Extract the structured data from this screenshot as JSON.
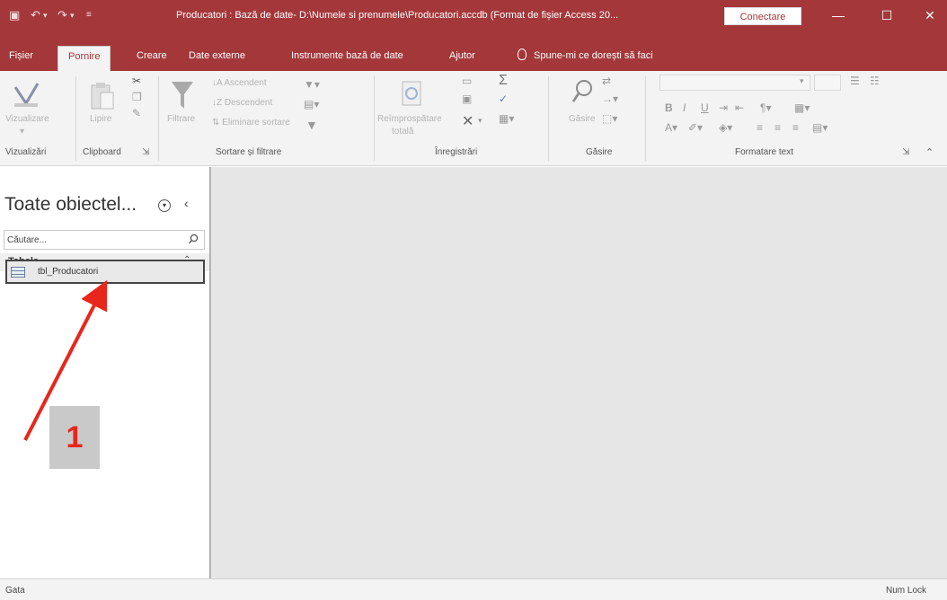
{
  "window": {
    "title": "Producatori : Bază de date- D:\\Numele si prenumele\\Producatori.accdb (Format de fișier Access 20...",
    "connect_label": "Conectare",
    "minimize": "—",
    "maximize": "☐",
    "close": "✕"
  },
  "tabs": [
    {
      "label": "Fișier"
    },
    {
      "label": "Pornire"
    },
    {
      "label": "Creare"
    },
    {
      "label": "Date externe"
    },
    {
      "label": "Instrumente bază de date"
    },
    {
      "label": "Ajutor"
    }
  ],
  "tell_me": "Spune-mi ce dorești să faci",
  "ribbon": {
    "groups": [
      {
        "label": "Vizualizări"
      },
      {
        "label": "Clipboard"
      },
      {
        "label": "Sortare și filtrare"
      },
      {
        "label": "Înregistrări"
      },
      {
        "label": "Găsire"
      },
      {
        "label": "Formatare text"
      }
    ],
    "buttons": {
      "view": "Vizualizare",
      "paste": "Lipire",
      "filter": "Filtrare",
      "ascending": "Ascendent",
      "descending": "Descendent",
      "remove_sort": "Eliminare sortare",
      "refresh": "Reîmprospătare",
      "refresh_sub": "totală",
      "find": "Găsire"
    }
  },
  "nav": {
    "title": "Toate obiectel...",
    "search_placeholder": "Căutare...",
    "group": "Tabele",
    "items": [
      {
        "label": "tbl_Producatori"
      }
    ]
  },
  "status": {
    "left": "Gata",
    "right": "Num Lock"
  },
  "annotation": {
    "number": "1",
    "color": "#e8261c"
  },
  "colors": {
    "accent": "#a4373a",
    "workspace": "#e6e6e6"
  }
}
